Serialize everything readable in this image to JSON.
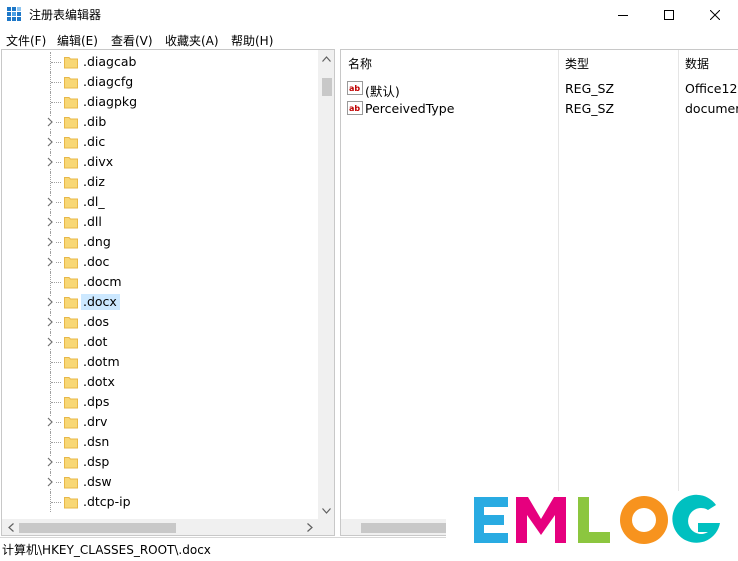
{
  "window": {
    "title": "注册表编辑器",
    "controls": {
      "minimize": "minimize",
      "maximize": "maximize",
      "close": "close"
    }
  },
  "menu": [
    {
      "label": "文件(F)"
    },
    {
      "label": "编辑(E)"
    },
    {
      "label": "查看(V)"
    },
    {
      "label": "收藏夹(A)"
    },
    {
      "label": "帮助(H)"
    }
  ],
  "tree": {
    "items": [
      {
        "label": ".diagcab",
        "expandable": false,
        "selected": false
      },
      {
        "label": ".diagcfg",
        "expandable": false,
        "selected": false
      },
      {
        "label": ".diagpkg",
        "expandable": false,
        "selected": false
      },
      {
        "label": ".dib",
        "expandable": true,
        "selected": false
      },
      {
        "label": ".dic",
        "expandable": true,
        "selected": false
      },
      {
        "label": ".divx",
        "expandable": true,
        "selected": false
      },
      {
        "label": ".diz",
        "expandable": false,
        "selected": false
      },
      {
        "label": ".dl_",
        "expandable": true,
        "selected": false
      },
      {
        "label": ".dll",
        "expandable": true,
        "selected": false
      },
      {
        "label": ".dng",
        "expandable": true,
        "selected": false
      },
      {
        "label": ".doc",
        "expandable": true,
        "selected": false
      },
      {
        "label": ".docm",
        "expandable": false,
        "selected": false
      },
      {
        "label": ".docx",
        "expandable": true,
        "selected": true
      },
      {
        "label": ".dos",
        "expandable": true,
        "selected": false
      },
      {
        "label": ".dot",
        "expandable": true,
        "selected": false
      },
      {
        "label": ".dotm",
        "expandable": false,
        "selected": false
      },
      {
        "label": ".dotx",
        "expandable": false,
        "selected": false
      },
      {
        "label": ".dps",
        "expandable": false,
        "selected": false
      },
      {
        "label": ".drv",
        "expandable": true,
        "selected": false
      },
      {
        "label": ".dsn",
        "expandable": false,
        "selected": false
      },
      {
        "label": ".dsp",
        "expandable": true,
        "selected": false
      },
      {
        "label": ".dsw",
        "expandable": true,
        "selected": false
      },
      {
        "label": ".dtcp-ip",
        "expandable": false,
        "selected": false
      }
    ]
  },
  "list": {
    "columns": [
      {
        "label": "名称"
      },
      {
        "label": "类型"
      },
      {
        "label": "数据"
      }
    ],
    "rows": [
      {
        "name": "(默认)",
        "type": "REG_SZ",
        "data": "Office12.",
        "icon": "string-value-icon"
      },
      {
        "name": "PerceivedType",
        "type": "REG_SZ",
        "data": "documer",
        "icon": "string-value-icon"
      }
    ]
  },
  "status": {
    "path": "计算机\\HKEY_CLASSES_ROOT\\.docx"
  },
  "watermark": {
    "letters": [
      {
        "char": "E",
        "color": "#29abe2"
      },
      {
        "char": "M",
        "color": "#e6007e"
      },
      {
        "char": "L",
        "color": "#8cc63f"
      },
      {
        "char": "O",
        "color": "#f7931e"
      },
      {
        "char": "G",
        "color": "#00c0c0"
      }
    ]
  },
  "colors": {
    "selection": "#cce8ff",
    "folder": "#f8d775",
    "folder_dark": "#e8b84a"
  }
}
